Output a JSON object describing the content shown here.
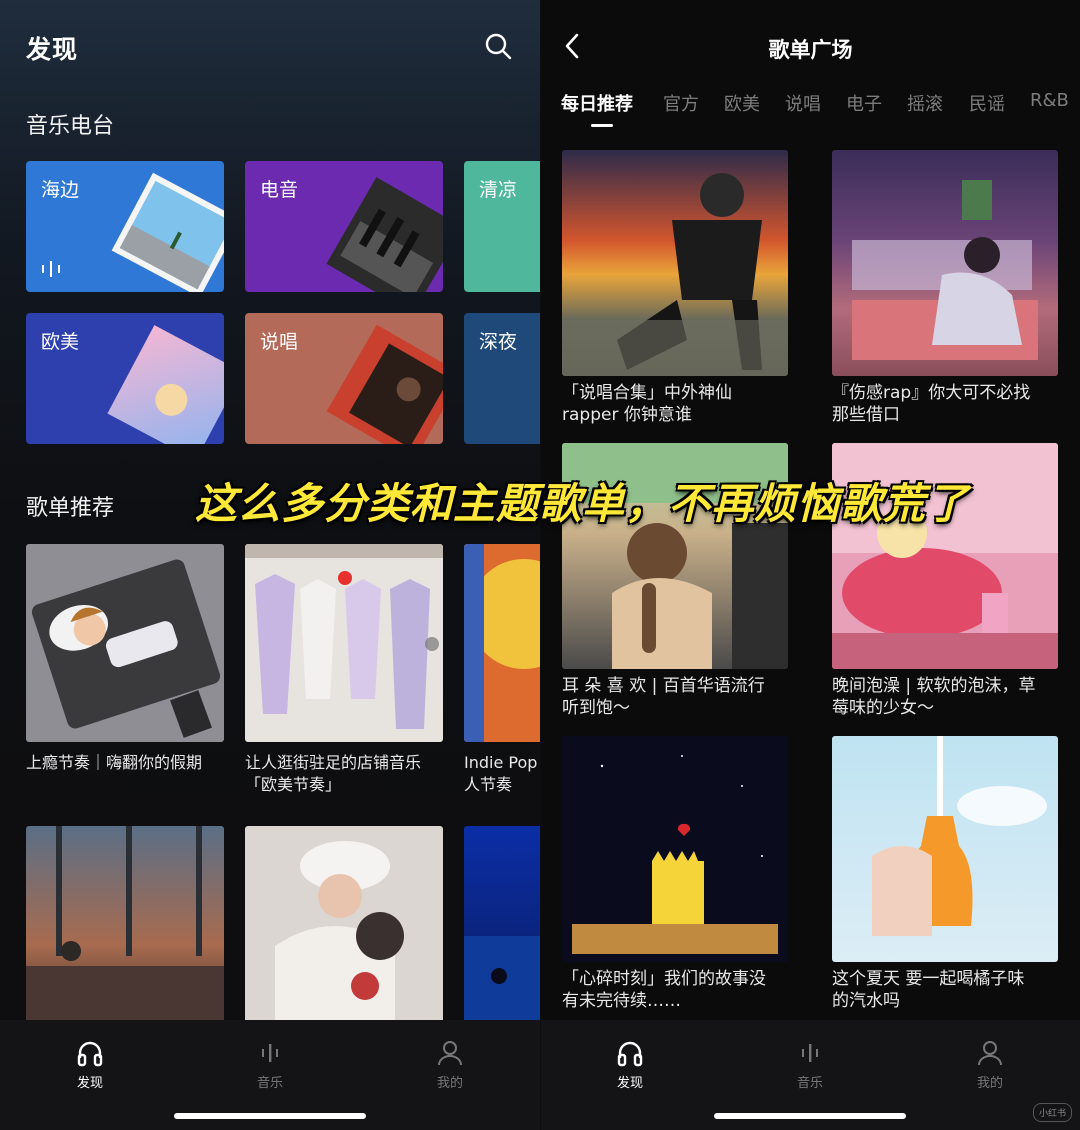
{
  "left": {
    "title": "发现",
    "radio_section": "音乐电台",
    "radio_tiles": [
      {
        "label": "海边",
        "color": "#2f78d6"
      },
      {
        "label": "电音",
        "color": "#6b2ab0"
      },
      {
        "label": "清凉",
        "color": "#4fb89c"
      },
      {
        "label": "欧美",
        "color": "#2e3fae"
      },
      {
        "label": "说唱",
        "color": "#b36a58"
      },
      {
        "label": "深夜",
        "color": "#1f4978"
      }
    ],
    "playlist_section": "歌单推荐",
    "playlists": [
      {
        "caption": "上瘾节奏｜嗨翻你的假期"
      },
      {
        "caption": "让人逛街驻足的店铺音乐\n「欧美节奏」"
      },
      {
        "caption": "Indie Pop\n人节奏"
      }
    ],
    "tabbar": [
      "发现",
      "音乐",
      "我的"
    ]
  },
  "right": {
    "title": "歌单广场",
    "tabs": [
      "每日推荐",
      "官方",
      "欧美",
      "说唱",
      "电子",
      "摇滚",
      "民谣",
      "R&B"
    ],
    "playlists": [
      {
        "caption": "「说唱合集」中外神仙\nrapper 你钟意谁"
      },
      {
        "caption": "『伤感rap』你大可不必找\n那些借口"
      },
      {
        "caption": "耳 朵 喜 欢 | 百首华语流行\n听到饱～"
      },
      {
        "caption": "晚间泡澡 | 软软的泡沫，草\n莓味的少女～"
      },
      {
        "caption": "「心碎时刻」我们的故事没\n有未完待续……"
      },
      {
        "caption": "这个夏天 要一起喝橘子味\n的汽水吗"
      }
    ],
    "tabbar": [
      "发现",
      "音乐",
      "我的"
    ]
  },
  "overlay_text": "这么多分类和主题歌单，不再烦恼歌荒了",
  "watermark": "小红书"
}
